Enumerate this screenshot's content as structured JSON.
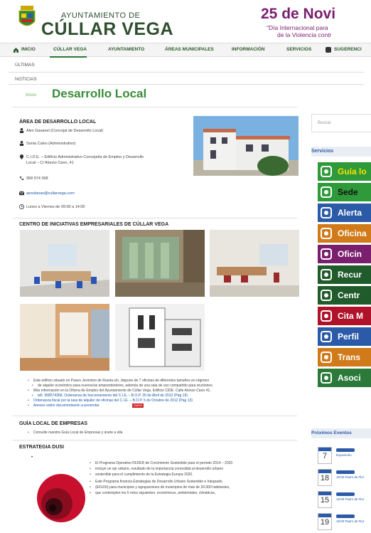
{
  "header": {
    "org_small": "AYUNTAMIENTO DE",
    "org_big": "CÚLLAR VEGA",
    "banner_date": "25 de Novi",
    "banner_line1": "\"Día Internacional para",
    "banner_line2": "de la Violencia contr"
  },
  "nav": {
    "items": [
      "INICIO",
      "CÚLLAR VEGA",
      "AYUNTAMIENTO",
      "ÁREAS MUNICIPALES",
      "INFORMACIÓN",
      "SERVICIOS",
      "SUGERENCI"
    ]
  },
  "breadcrumb": {
    "first": "ÚLTIMAS",
    "second": "NOTICIAS"
  },
  "page": {
    "home_tab": "Inicio",
    "title": "Desarrollo Local"
  },
  "area": {
    "heading": "ÁREA DE DESARROLLO LOCAL",
    "contacts": [
      "Alex Gasanel (Concejal de Desarrollo Local)",
      "Sonia Calvo (Administrativo)",
      "C.I.D.E. – Edificio Administrativo Concejalía de Empleo y Desarrollo",
      "Local – C/ Alonso Cano, 41",
      "958 574 368",
      "aesolanas@cullarvega.com",
      "Lunes a Viernes de 09:00 a 14:00"
    ]
  },
  "centro": {
    "heading": "CENTRO DE INICIATIVAS EMPRESARIALES DE CÚLLAR VEGA",
    "bullets": [
      "Este edificio situado en Paseo Jerónimo de Rueda s/n, dispone de 7 oficinas de diferentes tamaños en régimen",
      "de alquiler económico para nuevos/as emprendedores, además de una sala de uso compartido para reuniones.",
      "Más información en la Oficina de Empleo del Ayuntamiento de Cúllar Vega. Edificio CIDE. Calle Alonso Cano 41,",
      "telf. 958574368. Ordenanza de funcionamiento del C.I.E. – B.O.P. 20 de Abril de 2012 (Pág 19)",
      "Ordenanza fiscal por la tasa de alquiler de oficinas del C.I.E. – B.O.P. 5 de Octubre de 2012 (Pág 13)",
      "Anexos sobre documentación a presentar",
      "nuevo"
    ]
  },
  "guia": {
    "heading": "GUÍA LOCAL DE EMPRESAS",
    "bullet": "Consulte nuestra Guía Local de Empresas y únete a ella"
  },
  "dusi": {
    "heading": "ESTRATEGIA DUSI",
    "p1": "El Programa Operativo FEDER de Crecimiento Sostenible para el período 2014 – 2020",
    "p2": "incluye un eje urbano, resultado de la importancia concedida al desarrollo urbano",
    "p3": "sostenible para el cumplimiento de la Estrategia Europa 2020.",
    "p4": "Este Programa financia Estrategias de Desarrollo Urbano Sostenible e Integrado",
    "p5": "(EDUSI) para municipios y agrupaciones de municipios de más de 20.000 habitantes,",
    "p6": "que contemplen los 5 retos siguientes: económicos, ambientales, climáticos,"
  },
  "sidebar": {
    "search_placeholder": "Buscar",
    "services_heading": "Servicios",
    "services": [
      {
        "label": "Guía lo",
        "icon": "map-pin-icon",
        "bg": "#2e9a3a",
        "fg": "#f5e000"
      },
      {
        "label": "Sede",
        "icon": "monitor-icon",
        "bg": "#2e9a3a",
        "fg": "#111111"
      },
      {
        "label": "Alerta",
        "icon": "envelope-icon",
        "bg": "#2b5aa8",
        "fg": "#ffffff"
      },
      {
        "label": "Oficina",
        "icon": "building-icon",
        "bg": "#d07a1a",
        "fg": "#ffffff"
      },
      {
        "label": "Oficin",
        "icon": "flag-icon",
        "bg": "#7a1f6e",
        "fg": "#ffffff"
      },
      {
        "label": "Recur",
        "icon": "people-icon",
        "bg": "#1f5b2b",
        "fg": "#ffffff"
      },
      {
        "label": "Centr",
        "icon": "person-icon",
        "bg": "#1f5b2b",
        "fg": "#ffffff"
      },
      {
        "label": "Cita M",
        "icon": "stethoscope-icon",
        "bg": "#b0122a",
        "fg": "#ffffff"
      },
      {
        "label": "Perfil",
        "icon": "document-icon",
        "bg": "#2b5aa8",
        "fg": "#ffffff"
      },
      {
        "label": "Trans",
        "icon": "bus-icon",
        "bg": "#d07a1a",
        "fg": "#ffffff"
      },
      {
        "label": "Asoci",
        "icon": "group-icon",
        "bg": "#2b7a3a",
        "fg": "#ffffff"
      }
    ],
    "events_heading": "Próximos Eventos",
    "events": [
      {
        "day": "7",
        "text": "Exposición"
      },
      {
        "day": "18",
        "text": "18:00 Pasm de Flor"
      },
      {
        "day": "15",
        "text": "18:00 Pasm de Flor"
      },
      {
        "day": "19",
        "text": "18:00 Pasm de Flor"
      }
    ]
  }
}
